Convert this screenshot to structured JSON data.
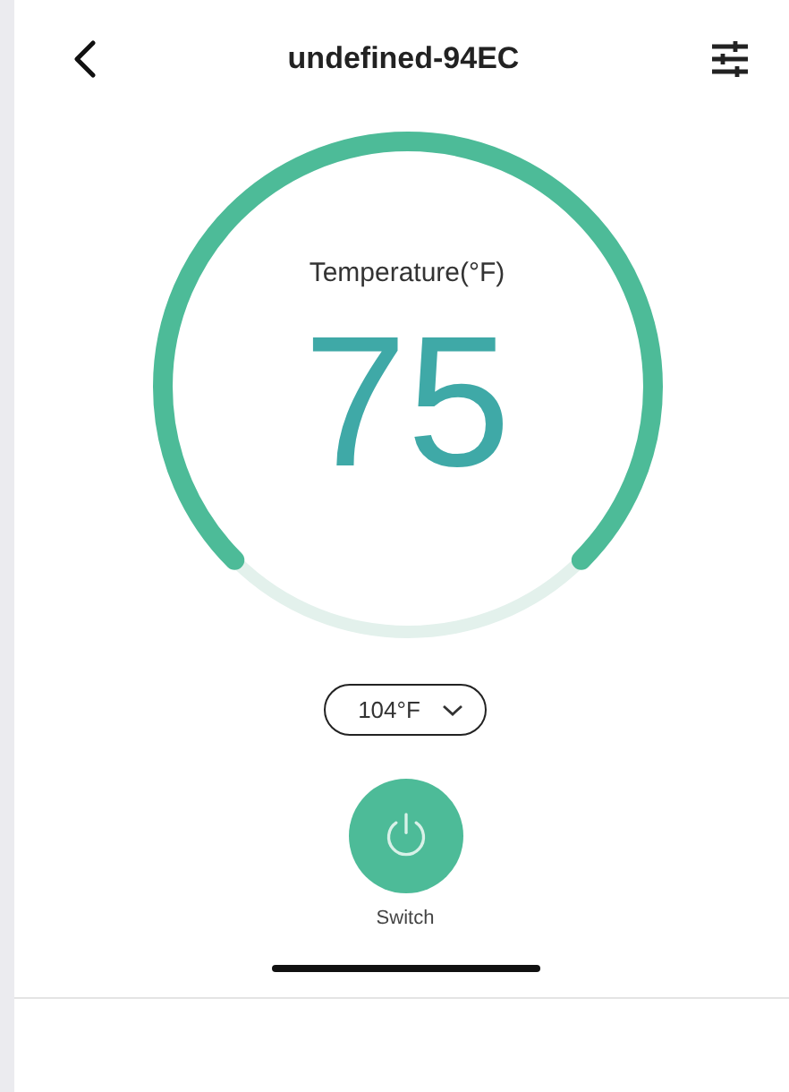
{
  "header": {
    "title": "undefined-94EC"
  },
  "gauge": {
    "label": "Temperature(°F)",
    "value": "75",
    "level": 1
  },
  "setpoint": {
    "value": "104°F"
  },
  "power": {
    "label": "Switch",
    "on": true
  }
}
